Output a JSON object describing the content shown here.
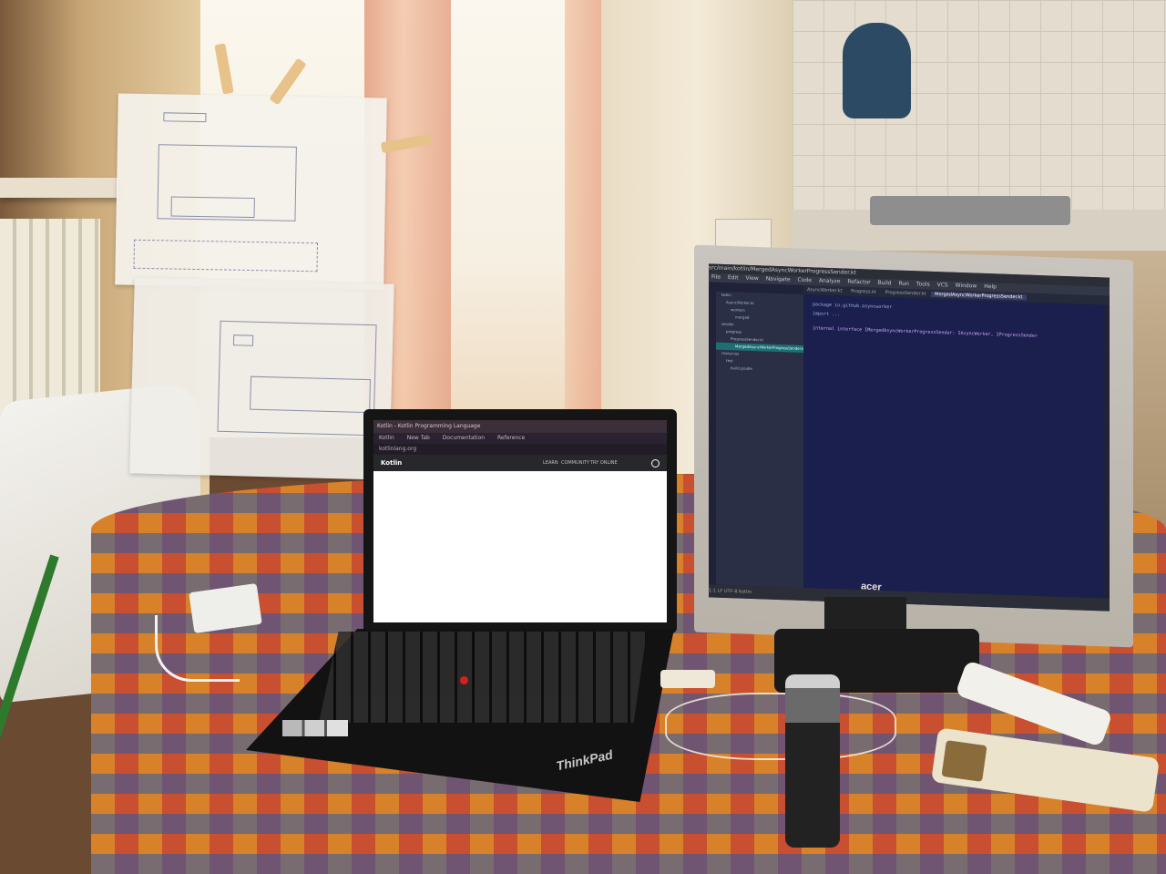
{
  "scene": {
    "laptop": {
      "brand_label": "ThinkPad",
      "browser": {
        "title_text": "Kotlin - Kotlin Programming Language",
        "tab_labels": [
          "Kotlin",
          "New Tab",
          "Documentation",
          "Reference"
        ],
        "address_text": "kotlinlang.org",
        "page_logo": "Kotlin",
        "nav_links": [
          "LEARN",
          "COMMUNITY",
          "TRY ONLINE"
        ]
      }
    },
    "monitor": {
      "brand_label": "acer",
      "ide": {
        "title_text": "src/main/kotlin/MergedAsyncWorkerProgressSender.kt",
        "menu_items": [
          "File",
          "Edit",
          "View",
          "Navigate",
          "Code",
          "Analyze",
          "Refactor",
          "Build",
          "Run",
          "Tools",
          "VCS",
          "Window",
          "Help"
        ],
        "tab_labels": [
          "AsyncWorker.kt",
          "Progress.kt",
          "ProgressSender.kt",
          "MergedAsyncWorkerProgressSender.kt"
        ],
        "tree_items": [
          "kotlin",
          "AsyncWorker.kt",
          "workers",
          "merged",
          "sender",
          "progress",
          "ProgressSender.kt",
          "MergedAsyncWorkerProgressSender.kt",
          "resources",
          "test",
          "build.gradle"
        ],
        "selected_tree_index": 7,
        "code_lines": [
          "package io.github.asyncworker",
          "import ...",
          "internal interface IMergedAsyncWorkerProgressSender: IAsyncWorker, IProgressSender"
        ],
        "status_text": "1:1  LF  UTF-8  Kotlin"
      }
    }
  }
}
